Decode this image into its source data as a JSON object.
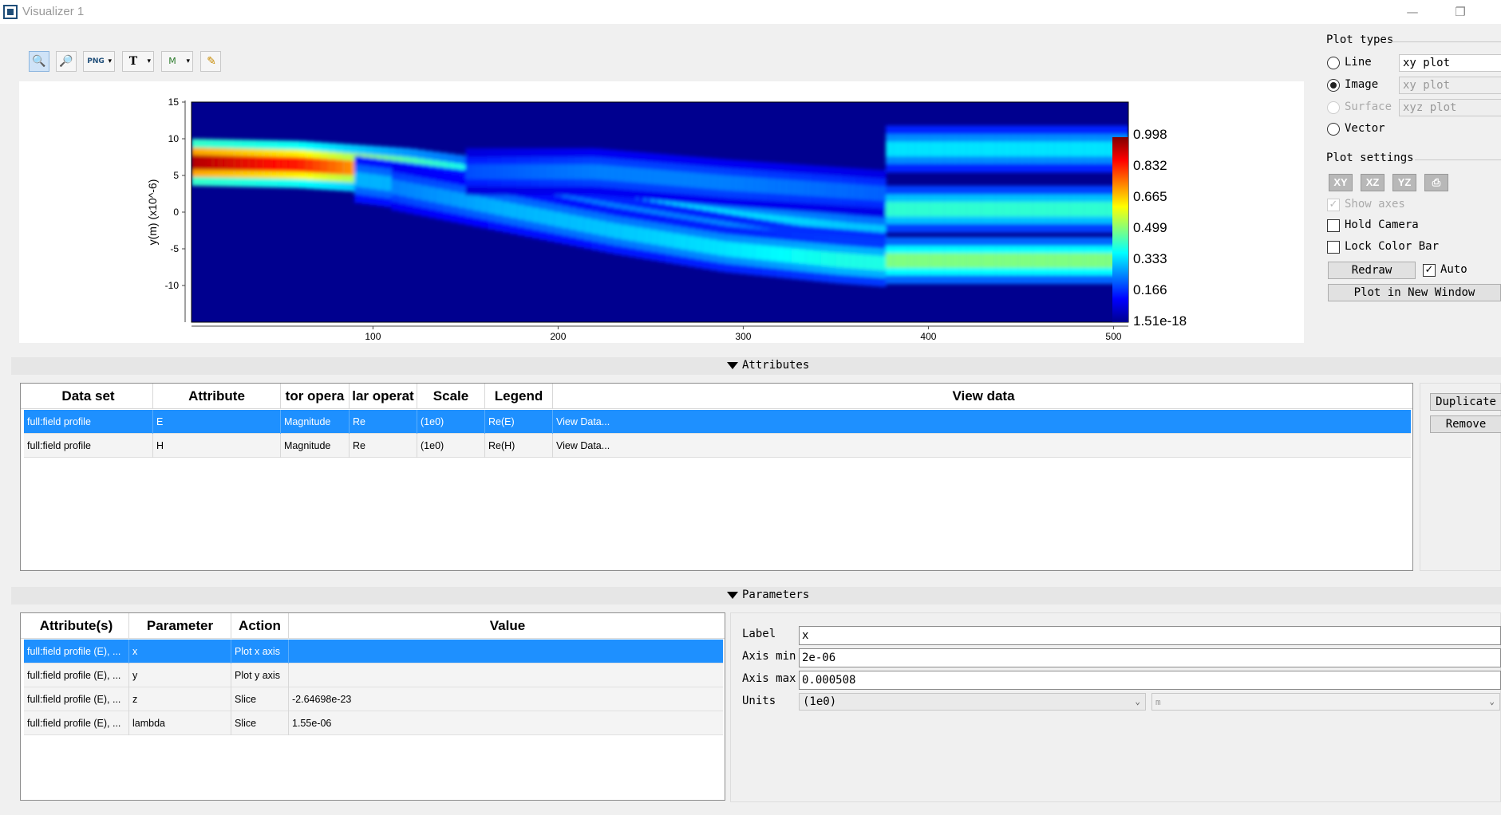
{
  "window": {
    "title": "Visualizer 1",
    "minimize": "—",
    "restore": "❐"
  },
  "toolbar": {
    "zoom_glyph": "🔍",
    "zoom_out_glyph": "🔎",
    "export_label": "PNG",
    "text_label": "T",
    "marker_label": "M",
    "pen_glyph": "✎",
    "dd": "▾"
  },
  "chart_data": {
    "type": "heatmap",
    "xlabel": "",
    "ylabel": "y(m) (x10^-6)",
    "xlim": [
      2,
      508
    ],
    "ylim": [
      -15,
      15
    ],
    "xticks": [
      100,
      200,
      300,
      400,
      500
    ],
    "yticks": [
      15,
      10,
      5,
      0,
      -5,
      -10
    ],
    "colorbar_ticks": [
      "0.998",
      "0.832",
      "0.665",
      "0.499",
      "0.333",
      "0.166",
      "1.51e-18"
    ],
    "colorscale": "jet",
    "beams": [
      {
        "x": [
          2,
          60,
          120,
          180,
          240,
          300,
          360,
          377
        ],
        "y": [
          6.8,
          6.5,
          5.5,
          3.5,
          1.0,
          -1.0,
          -2.5,
          -2.8
        ],
        "intensity": [
          0.95,
          0.85,
          0.6,
          0.45,
          0.38,
          0.35,
          0.32,
          0.32
        ]
      },
      {
        "x": [
          90,
          150,
          210,
          270,
          330,
          377
        ],
        "y": [
          4.5,
          2.5,
          0,
          -2.5,
          -5.0,
          -6.0
        ],
        "intensity": [
          0.3,
          0.3,
          0.35,
          0.35,
          0.38,
          0.38
        ]
      },
      {
        "x": [
          110,
          170,
          230,
          290,
          350,
          377
        ],
        "y": [
          3.5,
          0.5,
          -2.5,
          -5.0,
          -6.5,
          -7.0
        ],
        "intensity": [
          0.25,
          0.3,
          0.32,
          0.35,
          0.4,
          0.4
        ]
      },
      {
        "x": [
          150,
          220,
          290,
          377
        ],
        "y": [
          5.5,
          5.5,
          4.0,
          2.5
        ],
        "intensity": [
          0.2,
          0.25,
          0.25,
          0.22
        ]
      },
      {
        "x": [
          377,
          508
        ],
        "y": [
          8.6,
          8.6
        ],
        "intensity": [
          0.35,
          0.35
        ]
      },
      {
        "x": [
          377,
          508
        ],
        "y": [
          0.4,
          0.4
        ],
        "intensity": [
          0.42,
          0.42
        ]
      },
      {
        "x": [
          377,
          508
        ],
        "y": [
          -6.6,
          -6.6
        ],
        "intensity": [
          0.5,
          0.5
        ]
      }
    ]
  },
  "plot_types": {
    "title": "Plot types",
    "items": [
      {
        "label": "Line",
        "combo": "xy plot"
      },
      {
        "label": "Image",
        "combo": "xy plot"
      },
      {
        "label": "Surface",
        "combo": "xyz plot"
      },
      {
        "label": "Vector"
      }
    ]
  },
  "plot_settings": {
    "title": "Plot settings",
    "axis_buttons": [
      "XY",
      "XZ",
      "YZ"
    ],
    "show_axes": "Show axes",
    "hold_camera": "Hold Camera",
    "lock_color_bar": "Lock Color Bar",
    "redraw": "Redraw",
    "auto": "Auto",
    "plot_new_window": "Plot in New Window",
    "check": "✓"
  },
  "attributes": {
    "section_label": "Attributes",
    "columns": [
      "Data set",
      "Attribute",
      "tor opera",
      "lar operat",
      "Scale",
      "Legend",
      "View data"
    ],
    "rows": [
      [
        "full:field profile",
        "E",
        "Magnitude",
        "Re",
        "(1e0)",
        "Re(E)",
        "View Data..."
      ],
      [
        "full:field profile",
        "H",
        "Magnitude",
        "Re",
        "(1e0)",
        "Re(H)",
        "View Data..."
      ]
    ],
    "duplicate": "Duplicate",
    "remove": "Remove"
  },
  "parameters": {
    "section_label": "Parameters",
    "columns": [
      "Attribute(s)",
      "Parameter",
      "Action",
      "Value"
    ],
    "rows": [
      [
        "full:field profile (E), ...",
        "x",
        "Plot x axis",
        ""
      ],
      [
        "full:field profile (E), ...",
        "y",
        "Plot y axis",
        ""
      ],
      [
        "full:field profile (E), ...",
        "z",
        "Slice",
        "-2.64698e-23"
      ],
      [
        "full:field profile (E), ...",
        "lambda",
        "Slice",
        "1.55e-06"
      ]
    ],
    "label_label": "Label",
    "label_value": "x",
    "axis_min_label": "Axis min",
    "axis_min_value": "2e-06",
    "axis_max_label": "Axis max",
    "axis_max_value": "0.000508",
    "units_label": "Units",
    "units_value": "(1e0)",
    "units_unit": "m"
  }
}
